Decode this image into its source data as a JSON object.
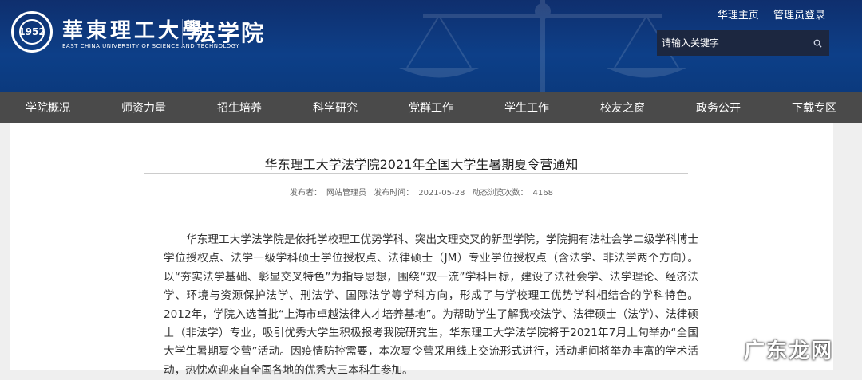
{
  "header": {
    "university_cn": "華東理工大學",
    "university_en": "EAST CHINA UNIVERSITY OF SCIENCE AND TECHNOLOGY",
    "logo_text": "1952",
    "college": "法学院",
    "top_links": [
      "华理主页",
      "管理员登录"
    ],
    "search_placeholder": "请输入关键字"
  },
  "nav": {
    "items": [
      "学院概况",
      "师资力量",
      "招生培养",
      "科学研究",
      "党群工作",
      "学生工作",
      "校友之窗",
      "政务公开",
      "下载专区"
    ]
  },
  "article": {
    "title": "华东理工大学法学院2021年全国大学生暑期夏令营通知",
    "publisher_label": "发布者：",
    "publisher": "网站管理员",
    "time_label": "发布时间：",
    "time": "2021-05-28",
    "views_label": "动态浏览次数：",
    "views": "4168",
    "body": "华东理工大学法学院是依托学校理工优势学科、突出文理交叉的新型学院，学院拥有法社会学二级学科博士学位授权点、法学一级学科硕士学位授权点、法律硕士（JM）专业学位授权点（含法学、非法学两个方向）。以“夯实法学基础、彰显交叉特色”为指导思想，围绕“双一流”学科目标，建设了法社会学、法学理论、经济法学、环境与资源保护法学、刑法学、国际法学等学科方向，形成了与学校理工优势学科相结合的学科特色。2012年，学院入选首批“上海市卓越法律人才培养基地”。为帮助学生了解我校法学、法律硕士（法学）、法律硕士（非法学）专业，吸引优秀大学生积极报考我院研究生，华东理工大学法学院将于2021年7月上旬举办“全国大学生暑期夏令营”活动。因疫情防控需要，本次夏令营采用线上交流形式进行，活动期间将举办丰富的学术活动，热忱欢迎来自全国各地的优秀大三本科生参加。"
  },
  "watermark": "广东龙网",
  "colors": {
    "header_bg": "#0d3f88",
    "nav_bg": "#4a4a4a",
    "search_bg": "#1c2740"
  }
}
